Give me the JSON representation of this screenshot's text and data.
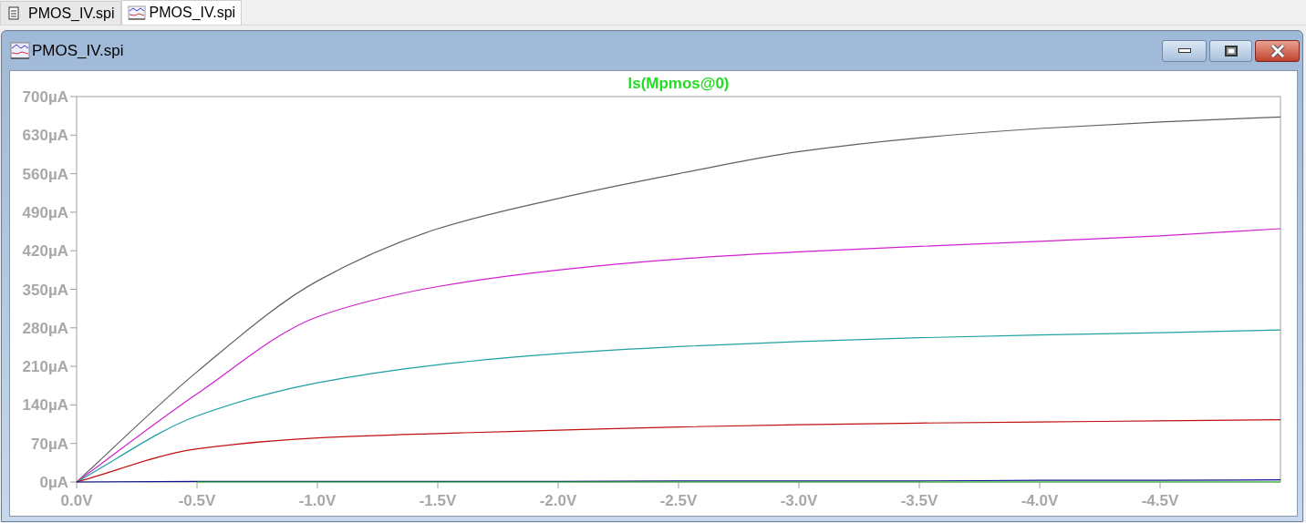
{
  "tabs": [
    {
      "label": "PMOS_IV.spi",
      "kind": "netlist",
      "selected": false
    },
    {
      "label": "PMOS_IV.spi",
      "kind": "waveform",
      "selected": true
    }
  ],
  "window": {
    "title": "PMOS_IV.spi"
  },
  "plot": {
    "chart_data": {
      "type": "line",
      "title": "Is(Mpmos@0)",
      "x": [
        0,
        -0.5,
        -1,
        -1.5,
        -2,
        -2.5,
        -3,
        -3.5,
        -4,
        -4.5,
        -5
      ],
      "series": [
        {
          "color": "#606060",
          "values": [
            0,
            200,
            365,
            460,
            515,
            560,
            600,
            625,
            642,
            654,
            663
          ]
        },
        {
          "color": "#d020d0",
          "values": [
            0,
            160,
            300,
            355,
            385,
            405,
            418,
            428,
            437,
            447,
            460
          ]
        },
        {
          "color": "#20a0a0",
          "values": [
            0,
            120,
            180,
            213,
            233,
            246,
            255,
            262,
            267,
            271,
            276
          ]
        },
        {
          "color": "#c01010",
          "values": [
            0,
            60,
            80,
            88,
            94,
            100,
            104,
            107,
            109,
            111,
            113
          ]
        },
        {
          "color": "#101090",
          "values": [
            0,
            1,
            1,
            1,
            1,
            2,
            2,
            2,
            3,
            3,
            4
          ]
        },
        {
          "color": "#20c020",
          "values": [
            null,
            0,
            0,
            0,
            0,
            0,
            0,
            0,
            0,
            0,
            0
          ]
        }
      ],
      "xlim": [
        0,
        -5
      ],
      "ylim": [
        0,
        700
      ],
      "xticks": [
        {
          "value": 0,
          "label": "0.0V"
        },
        {
          "value": -0.5,
          "label": "-0.5V"
        },
        {
          "value": -1,
          "label": "-1.0V"
        },
        {
          "value": -1.5,
          "label": "-1.5V"
        },
        {
          "value": -2,
          "label": "-2.0V"
        },
        {
          "value": -2.5,
          "label": "-2.5V"
        },
        {
          "value": -3,
          "label": "-3.0V"
        },
        {
          "value": -3.5,
          "label": "-3.5V"
        },
        {
          "value": -4,
          "label": "-4.0V"
        },
        {
          "value": -4.5,
          "label": "-4.5V"
        }
      ],
      "yticks": [
        {
          "value": 0,
          "label": "0µA"
        },
        {
          "value": 70,
          "label": "70µA"
        },
        {
          "value": 140,
          "label": "140µA"
        },
        {
          "value": 210,
          "label": "210µA"
        },
        {
          "value": 280,
          "label": "280µA"
        },
        {
          "value": 350,
          "label": "350µA"
        },
        {
          "value": 420,
          "label": "420µA"
        },
        {
          "value": 490,
          "label": "490µA"
        },
        {
          "value": 560,
          "label": "560µA"
        },
        {
          "value": 630,
          "label": "630µA"
        },
        {
          "value": 700,
          "label": "700µA"
        }
      ]
    }
  }
}
